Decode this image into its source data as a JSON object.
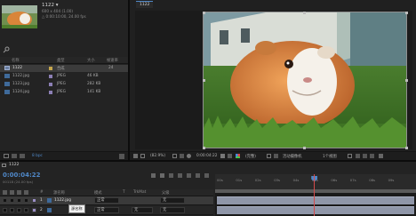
{
  "project": {
    "comp_name": "1122 ▾",
    "comp_info_size": "600 x 404 (1.00)",
    "comp_info_duration": "△ 0:00:10:00, 24.00 fps",
    "search_icon": "search-icon",
    "columns": {
      "name": "名称",
      "type": "类型",
      "size": "大小",
      "fps": "帧速率"
    },
    "items": [
      {
        "name": "1122",
        "type": "合成",
        "size": "",
        "fps": "24",
        "icon": "composition-icon",
        "selected": true
      },
      {
        "name": "1122.jpg",
        "type": "JPEG",
        "size": "46 KB",
        "fps": "",
        "icon": "image-file-icon"
      },
      {
        "name": "1123.jpg",
        "type": "JPEG",
        "size": "282 KB",
        "fps": "",
        "icon": "image-file-icon"
      },
      {
        "name": "1124.jpg",
        "type": "JPEG",
        "size": "141 KB",
        "fps": "",
        "icon": "image-file-icon"
      }
    ],
    "bpc": "8 bpc"
  },
  "composition": {
    "tab": "1122",
    "bar": {
      "zoom": "(82.9%)",
      "timecode": "0:00:04:22",
      "resolution": "(完整)",
      "camera": "活动摄像机",
      "view": "1个视图"
    },
    "colors": {
      "accent": "#4f87c7",
      "frame_outline": "#8f8f8f"
    }
  },
  "timeline": {
    "tab": "1122",
    "current_time": "0:00:04:22",
    "fps_label": "00118 (24.00 fps)",
    "columns": {
      "num": "#",
      "source": "源名称",
      "mode": "模式",
      "t": "T",
      "trkmat": "TrkMat",
      "parent": "父级"
    },
    "layers": [
      {
        "num": "1",
        "name": "1122.jpg",
        "mode": "正常",
        "trkmat": "",
        "parent": "无"
      },
      {
        "num": "2",
        "name": "",
        "mode": "正常",
        "trkmat": "无",
        "parent": "无"
      }
    ],
    "tooltip": "源名称",
    "ruler_ticks": [
      "00s",
      "01s",
      "02s",
      "03s",
      "04s",
      "05s",
      "06s",
      "07s",
      "08s",
      "09s"
    ],
    "playhead_seconds": 4.917,
    "duration_seconds": 10
  }
}
